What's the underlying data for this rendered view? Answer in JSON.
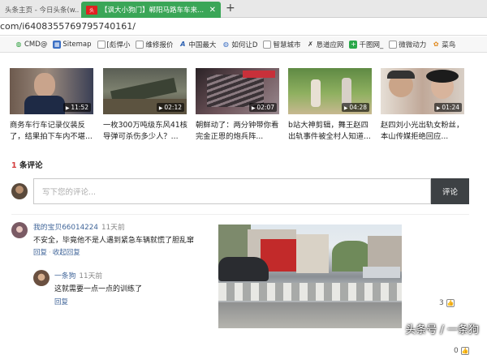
{
  "browser": {
    "tabs": [
      {
        "label": "头条主页 - 今日头条(w..."
      },
      {
        "label": "【讽大小狗门】郸阳马路车车来..."
      }
    ],
    "new_tab": "+",
    "url_prefix": "com/",
    "url_path": "i6408355769795740161/"
  },
  "bookmarks": [
    {
      "label": "CMD@",
      "icon": "globe-icon"
    },
    {
      "label": "Sitemap",
      "icon": "sitemap-icon"
    },
    {
      "label": "[彪悍小",
      "icon": "page-icon"
    },
    {
      "label": "维修报价",
      "icon": "page-icon"
    },
    {
      "label": "中国最大",
      "icon": "a-logo-icon"
    },
    {
      "label": "如何让D",
      "icon": "globe-icon"
    },
    {
      "label": "智慧城市",
      "icon": "page-icon"
    },
    {
      "label": "恳道应网",
      "icon": "runner-icon"
    },
    {
      "label": "千图网_",
      "icon": "plus-green-icon"
    },
    {
      "label": "微微动力",
      "icon": "page-icon"
    },
    {
      "label": "菜鸟",
      "icon": "flower-icon"
    }
  ],
  "videos": [
    {
      "title": "商务车行车记录仪装反了，结果拍下车内不堪...",
      "duration": "11:52"
    },
    {
      "title": "一枚300万吨级东风41核导弹可杀伤多少人？...",
      "duration": "02:12"
    },
    {
      "title": "朝鲜动了：两分钟带你看完金正恩的炮兵阵...",
      "duration": "02:07"
    },
    {
      "title": "b站大神剪辑，舞王赵四出轨事件被全村人知道...",
      "duration": "04:28"
    },
    {
      "title": "赵四刘小光出轨女粉丝，本山传媒拒绝回应...",
      "duration": "01:24"
    }
  ],
  "comments_header": {
    "count": "1",
    "label": "条评论"
  },
  "comment_input": {
    "placeholder": "写下您的评论...",
    "button": "评论"
  },
  "comments": [
    {
      "user": "我的宝贝66014224",
      "time": "11天前",
      "text": "不安全，毕竟他不是人遇到紧急车辆就慌了胆乱窜",
      "actions": [
        "回复",
        "收起回复"
      ],
      "likes": "3"
    }
  ],
  "reply": {
    "user": "一条狗",
    "time": "11天前",
    "text": "这就需要一点一点的训练了",
    "action": "回复",
    "likes": "0"
  },
  "watermark": "头条号 / 一条狗"
}
